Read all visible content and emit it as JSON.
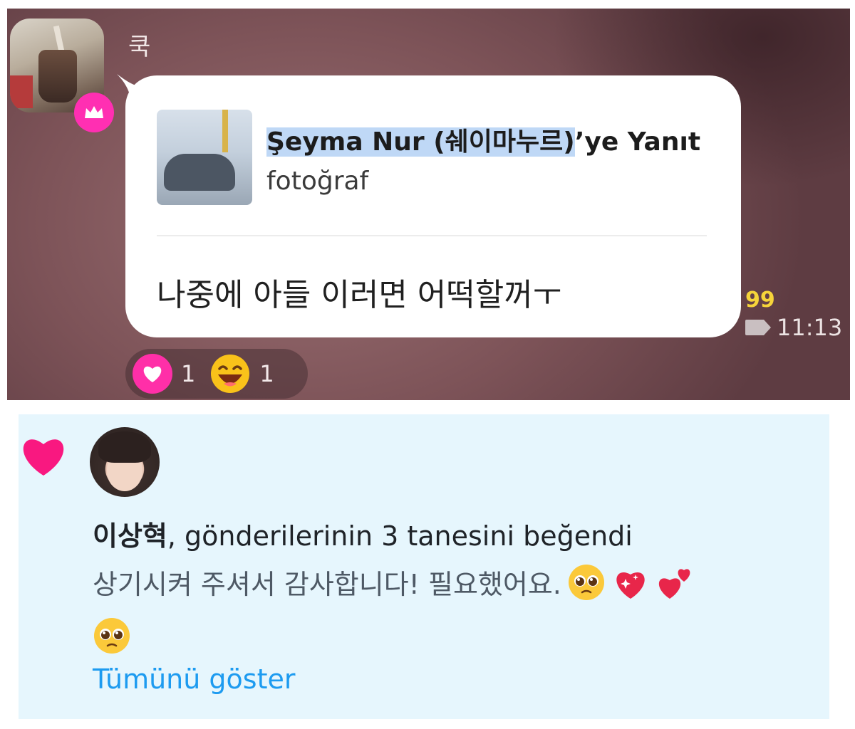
{
  "chat": {
    "sender_name": "쿡",
    "reply_title_highlight": "Şeyma Nur (쉐이마누르)",
    "reply_title_rest": "’ye Yanıt",
    "reply_subtitle": "fotoğraf",
    "message": "나중에 아들 이러면 어떡할꺼ㅜ",
    "unread_count": "99",
    "time": "11:13",
    "reactions": [
      {
        "icon": "heart-icon",
        "count": "1"
      },
      {
        "icon": "laughing-face-icon",
        "count": "1"
      }
    ],
    "colors": {
      "crown_badge": "#ff2fb2",
      "unread": "#f6d43a",
      "highlight": "#bfd8f6"
    }
  },
  "notification": {
    "icon": "heart-icon",
    "user_name": "이상혁",
    "action_text": ", gönderilerinin 3 tanesini beğendi",
    "body_text": "상기시켜 주셔서 감사합니다! 필요했어요.",
    "body_emojis": [
      "pleading-face-icon",
      "sparkling-heart-icon",
      "two-hearts-icon",
      "pleading-face-icon"
    ],
    "show_more": "Tümünü göster",
    "colors": {
      "heart": "#f91880",
      "link": "#1d9bf0",
      "background": "#e6f6fd"
    }
  }
}
